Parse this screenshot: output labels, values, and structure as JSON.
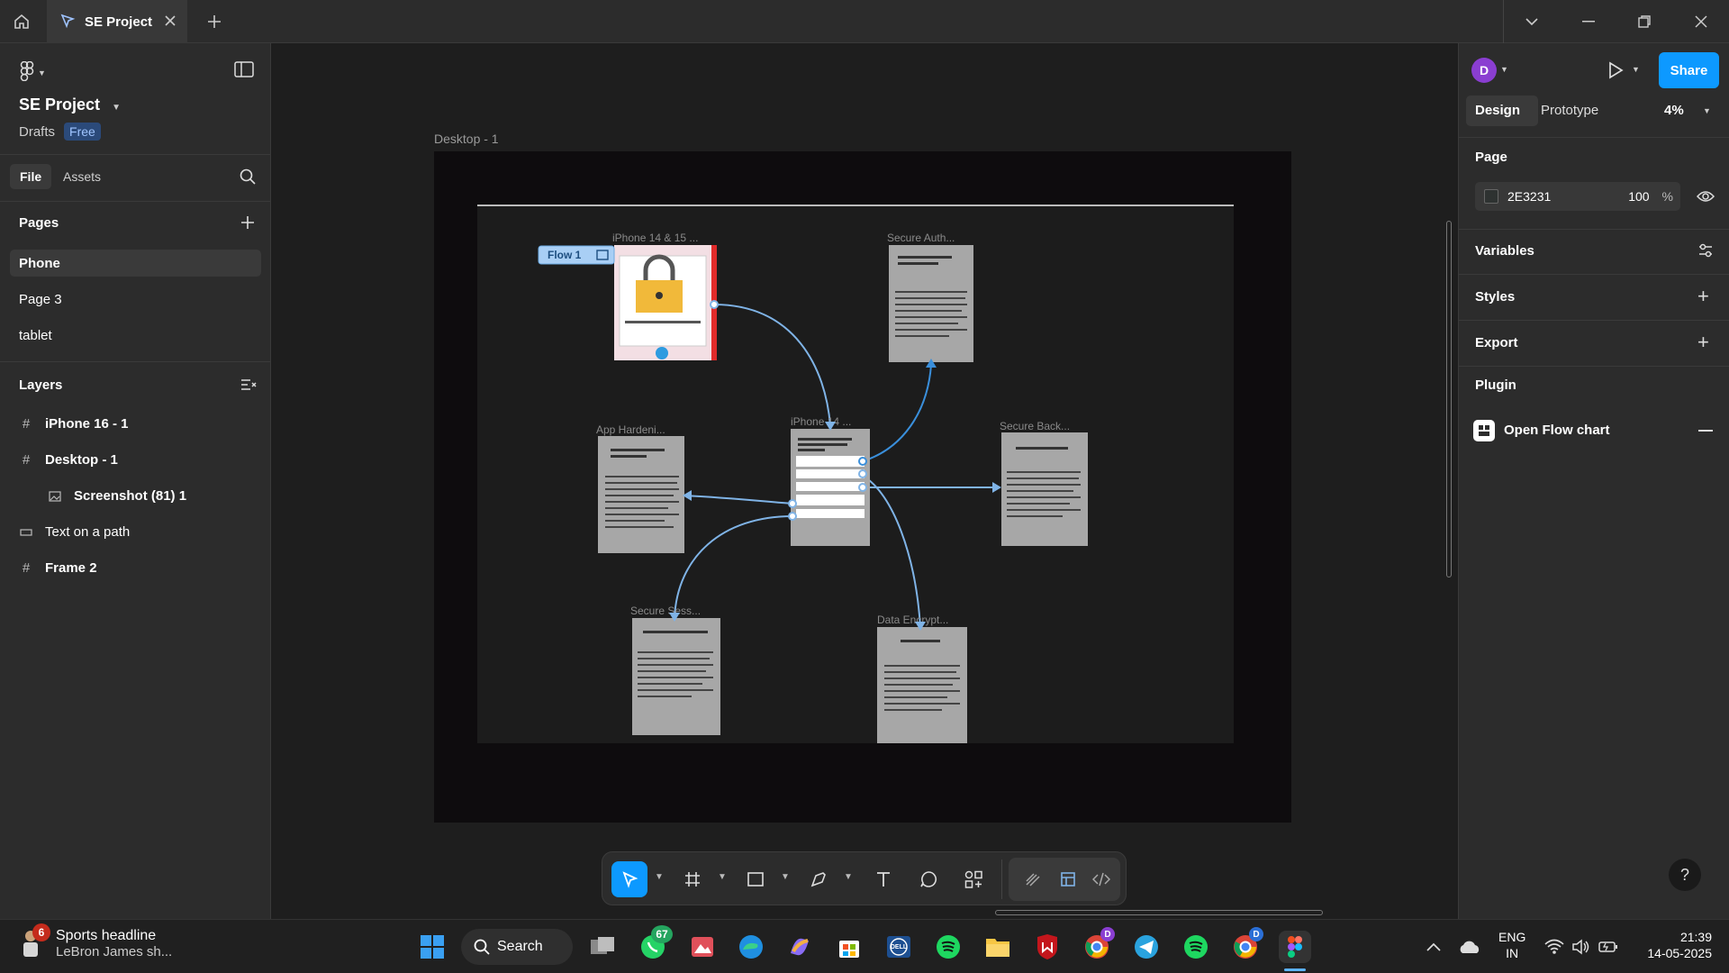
{
  "titlebar": {
    "tab_title": "SE Project",
    "icons": [
      "home-icon",
      "figma-file-icon",
      "close-icon",
      "plus-icon",
      "chevron-down-icon",
      "minimize-icon",
      "restore-icon",
      "window-close-icon"
    ]
  },
  "left_panel": {
    "project_title": "SE Project",
    "location": "Drafts",
    "plan_badge": "Free",
    "tabs": {
      "file": "File",
      "assets": "Assets"
    },
    "pages_heading": "Pages",
    "pages": [
      {
        "label": "Phone",
        "active": true
      },
      {
        "label": "Page 3",
        "active": false
      },
      {
        "label": "tablet",
        "active": false
      }
    ],
    "layers_heading": "Layers",
    "layers": [
      {
        "label": "iPhone 16 - 1",
        "icon": "frame-icon"
      },
      {
        "label": "Desktop - 1",
        "icon": "frame-icon"
      },
      {
        "label": "Screenshot (81) 1",
        "icon": "image-icon"
      },
      {
        "label": "Text on a path",
        "icon": "text-path-icon"
      },
      {
        "label": "Frame 2",
        "icon": "frame-icon"
      }
    ]
  },
  "canvas": {
    "frame_label": "Desktop - 1",
    "flow_label": "Flow 1",
    "cards": [
      {
        "title": "iPhone 14 & 15 ..."
      },
      {
        "title": "Secure Auth..."
      },
      {
        "title": "App Hardeni..."
      },
      {
        "title": "iPhone 14 ..."
      },
      {
        "title": "Secure Back..."
      },
      {
        "title": "Secure Sess..."
      },
      {
        "title": "Data Encrypt..."
      }
    ]
  },
  "right_panel": {
    "avatar_letter": "D",
    "share_label": "Share",
    "tabs": {
      "design": "Design",
      "prototype": "Prototype"
    },
    "zoom": "4%",
    "page_heading": "Page",
    "page_color": "2E3231",
    "page_opacity": "100",
    "percent_sign": "%",
    "variables": "Variables",
    "styles": "Styles",
    "export": "Export",
    "plugin": "Plugin",
    "plugin_item": "Open Flow chart",
    "help": "?"
  },
  "taskbar": {
    "news_title": "Sports headline",
    "news_sub": "LeBron James sh...",
    "news_badge": "6",
    "search_label": "Search",
    "whatsapp_badge": "67",
    "chrome_badge": "D",
    "dell_label": "DELL",
    "lang_top": "ENG",
    "lang_bottom": "IN",
    "time": "21:39",
    "date": "14-05-2025"
  },
  "colors": {
    "accent": "#0d99ff",
    "panel": "#2c2c2c",
    "canvas": "#1e1e1e"
  }
}
